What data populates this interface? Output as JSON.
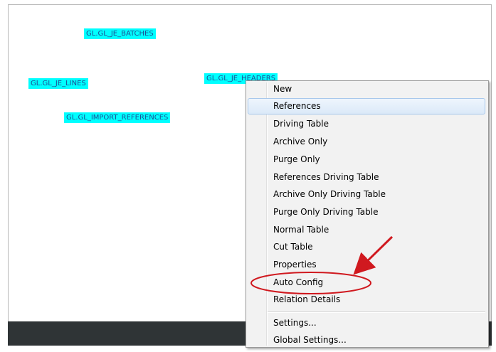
{
  "tables": [
    {
      "name": "GL.GL_JE_BATCHES"
    },
    {
      "name": "GL.GL_JE_LINES"
    },
    {
      "name": "GL.GL_JE_HEADERS"
    },
    {
      "name": "GL.GL_IMPORT_REFERENCES"
    }
  ],
  "context_menu": {
    "items": [
      {
        "label": "New"
      },
      {
        "label": "References"
      },
      {
        "label": "Driving Table"
      },
      {
        "label": "Archive Only"
      },
      {
        "label": "Purge Only"
      },
      {
        "label": "References  Driving Table"
      },
      {
        "label": "Archive Only  Driving Table"
      },
      {
        "label": "Purge Only  Driving Table"
      },
      {
        "label": "Normal Table"
      },
      {
        "label": "Cut Table"
      },
      {
        "label": "Properties"
      },
      {
        "label": "Auto Config"
      },
      {
        "label": "Relation Details"
      },
      {
        "label": "Settings..."
      },
      {
        "label": "Global Settings..."
      }
    ],
    "highlighted_item": "References"
  },
  "annotation": {
    "highlight_color": "#d0191f",
    "icon": "arrow-icon"
  },
  "colors": {
    "table_node_bg": "#00ffff",
    "table_node_text": "#1d4f95",
    "bottom_bar": "#2f3436"
  }
}
